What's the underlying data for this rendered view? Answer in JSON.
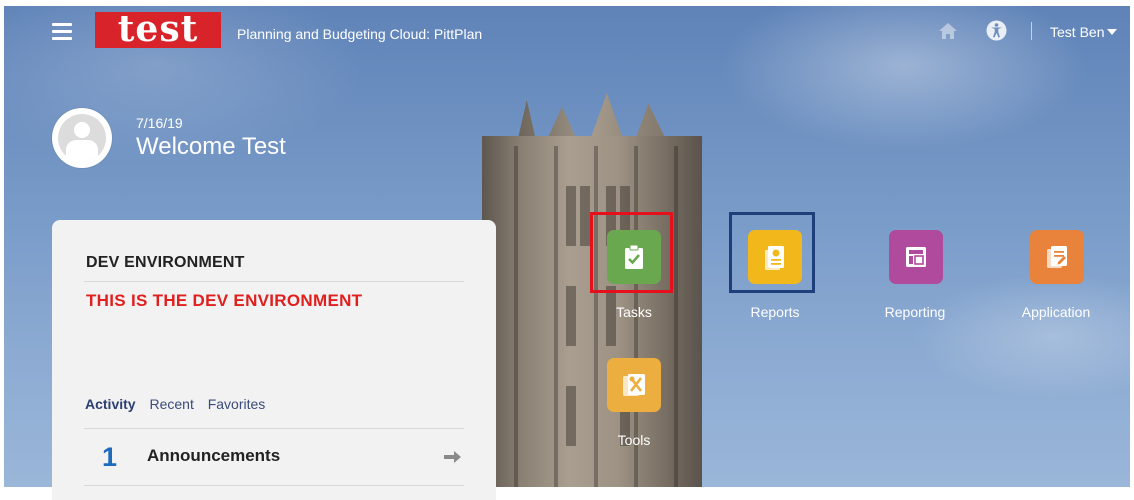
{
  "header": {
    "logo_text": "test",
    "app_title": "Planning and Budgeting Cloud: PittPlan",
    "user_name": "Test Ben",
    "icons": [
      "menu-icon",
      "home-icon",
      "accessibility-icon",
      "caret-down-icon"
    ]
  },
  "welcome": {
    "date": "7/16/19",
    "greeting": "Welcome Test"
  },
  "panel": {
    "heading": "DEV ENVIRONMENT",
    "message": "THIS IS THE DEV ENVIRONMENT",
    "tabs": [
      {
        "label": "Activity",
        "active": true
      },
      {
        "label": "Recent",
        "active": false
      },
      {
        "label": "Favorites",
        "active": false
      }
    ],
    "announcement": {
      "count": "1",
      "label": "Announcements"
    }
  },
  "tiles": [
    {
      "label": "Tasks",
      "icon": "clipboard-check-icon",
      "color": "#6aa84f"
    },
    {
      "label": "Reports",
      "icon": "report-document-icon",
      "color": "#f2b71a"
    },
    {
      "label": "Reporting",
      "icon": "reporting-icon",
      "color": "#b04a9c"
    },
    {
      "label": "Application",
      "icon": "application-icon",
      "color": "#e9823a"
    },
    {
      "label": "Tools",
      "icon": "tools-icon",
      "color": "#ecae3e"
    }
  ],
  "colors": {
    "logo_red": "#d9232a",
    "dev_message_red": "#e0201f",
    "highlight_red": "#e5101b",
    "highlight_blue": "#1f3f7a"
  }
}
